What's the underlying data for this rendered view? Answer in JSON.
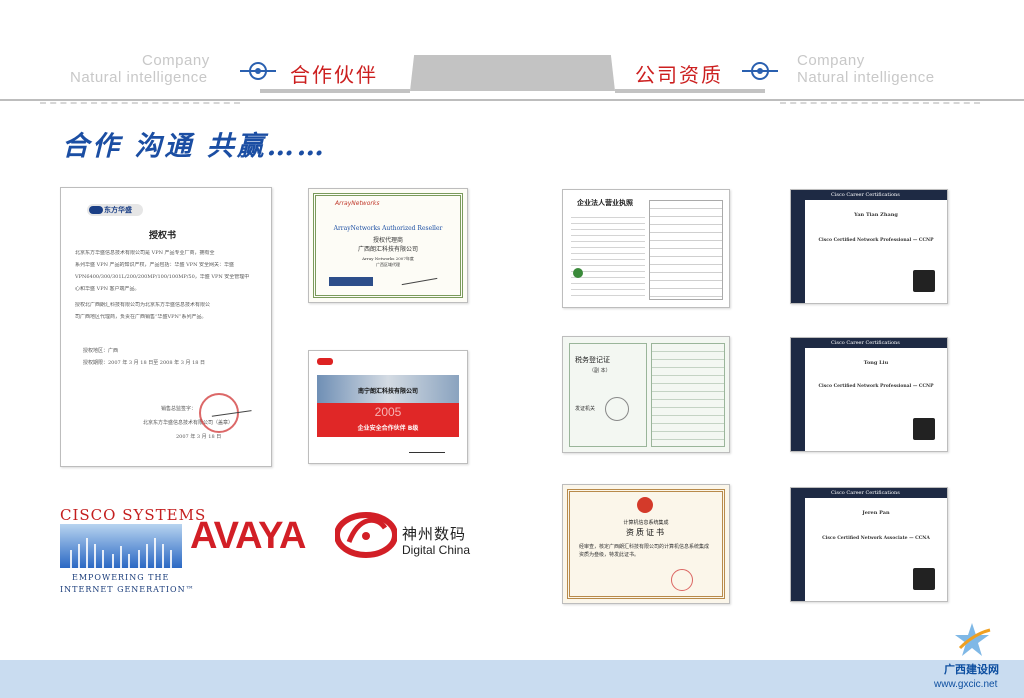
{
  "header": {
    "left_en_line1": "Company",
    "left_en_line2": "Natural intelligence",
    "left_cn": "合作伙伴",
    "right_cn": "公司资质",
    "right_en_line1": "Company",
    "right_en_line2": "Natural intelligence"
  },
  "slogan": "合作 沟通 共赢……",
  "authorization": {
    "brand": "东方华盛",
    "title": "授权书",
    "body_lines": [
      "北京东方华盛信息技术有限公司是 VPN 产品专业厂商，拥有全",
      "系列华盛 VPN 产品的知识产权，产品包括：华盛 VPN 安全网关：华盛",
      "VPN6400/300/301L/200/200MP/100/100MP/50，华盛 VPN 安全管理中",
      "心和华盛 VPN 客户端产品。",
      "授权北广西朗汇科技有限公司为北京东方华盛信息技术有限公",
      "司广西地区代理商，负责在广西销售“华盛VPN”系列产品。"
    ],
    "region_label": "授权地区：广西",
    "period_label": "授权期限：2007 年 3 月 18 日至 2008 年 3 月 18 日",
    "sign_line1": "销售总监签字：",
    "sign_line2": "北京东方华盛信息技术有限公司（盖章）",
    "sign_date": "2007 年 3 月 18 日"
  },
  "array_cert": {
    "brand": "ArrayNetworks",
    "title_en": "ArrayNetworks Authorized Reseller",
    "title_cn": "授权代理商",
    "company": "广西朗汇科技有限公司",
    "line": "Array Networks 2007年度",
    "region": "广西区域代理"
  },
  "trend_cert": {
    "company": "南宁朗汇科技有限公司",
    "year": "2005",
    "level": "企业安全合作伙伴 B级"
  },
  "business_license": {
    "title": "企业法人营业执照"
  },
  "tax_cert": {
    "title": "税务登记证",
    "subtitle": "（副 本）",
    "issuer_label": "发证机关"
  },
  "qualification_cert": {
    "org": "计算机信息系统集成",
    "title": "资质证书",
    "body": "经审查，核定广西朗汇科技有限公司的计算机信息系统集成资质为叁级，特发此证书。"
  },
  "cisco_certs": [
    {
      "band": "Cisco Career Certifications",
      "name": "Yan Tian Zhang",
      "cert": "Cisco Certified Network Professional — CCNP"
    },
    {
      "band": "Cisco Career Certifications",
      "name": "Tong Liu",
      "cert": "Cisco Certified Network Professional — CCNP"
    },
    {
      "band": "Cisco Career Certifications",
      "name": "Jeren Pan",
      "cert": "Cisco Certified Network Associate — CCNA"
    }
  ],
  "logos": {
    "cisco_name": "CISCO SYSTEMS",
    "cisco_tag1": "EMPOWERING THE",
    "cisco_tag2": "INTERNET GENERATION™",
    "avaya": "AVAYA",
    "dc_cn": "神州数码",
    "dc_en": "Digital China"
  },
  "watermark": {
    "cn": "广西建设网",
    "url": "www.gxcic.net"
  },
  "colors": {
    "accent_red": "#cc1f1f",
    "accent_blue": "#1b4ea3",
    "band_blue": "#c9dcf0"
  }
}
